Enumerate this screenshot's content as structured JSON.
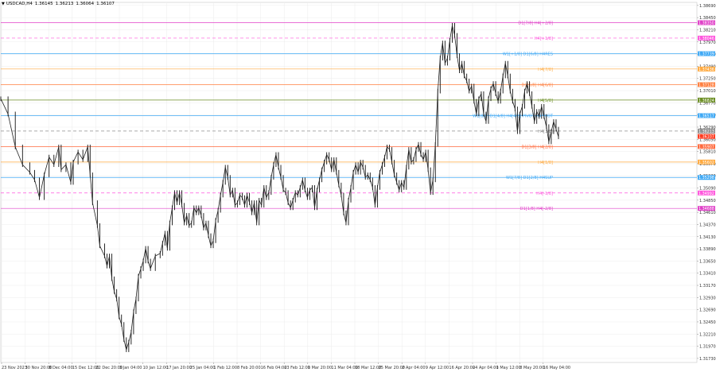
{
  "header": {
    "dropdown_icon": "triangle-down-icon",
    "symbol_tf": "USDCAD,H4",
    "open": "1.36145",
    "high": "1.36213",
    "low": "1.36064",
    "close": "1.36107"
  },
  "chart_data": {
    "type": "candlestick",
    "symbol": "USDCAD",
    "timeframe": "H4",
    "y_ticks": [
      "1.38690",
      "1.38450",
      "1.38210",
      "1.37970",
      "1.37730",
      "1.37490",
      "1.37250",
      "1.37010",
      "1.36770",
      "1.36530",
      "1.36290",
      "1.36050",
      "1.35810",
      "1.35570",
      "1.35330",
      "1.35090",
      "1.34850",
      "1.34610",
      "1.34370",
      "1.34130",
      "1.33890",
      "1.33650",
      "1.33410",
      "1.33170",
      "1.32930",
      "1.32690",
      "1.32450",
      "1.32210",
      "1.31970",
      "1.31730"
    ],
    "ylim": [
      1.3165,
      1.3875
    ],
    "x_ticks": [
      "23 Nov 2023",
      "30 Nov 20:00",
      "8 Dec 04:00",
      "15 Dec 12:00",
      "22 Dec 20:00",
      "3 Jan 04:00",
      "10 Jan 12:00",
      "17 Jan 20:00",
      "25 Jan 04:00",
      "1 Feb 12:00",
      "8 Feb 20:00",
      "16 Feb 04:00",
      "23 Feb 12:00",
      "1 Mar 20:00",
      "11 Mar 04:00",
      "18 Mar 12:00",
      "25 Mar 20:00",
      "2 Apr 04:00",
      "9 Apr 12:00",
      "16 Apr 20:00",
      "24 Apr 04:00",
      "1 May 12:00",
      "8 May 20:00",
      "16 May 04:00"
    ],
    "levels": [
      {
        "label": "D1[7/8] H4[+2/8]",
        "price": 1.3835,
        "price_label": "1.38350",
        "color": "#e040c8",
        "style": "solid"
      },
      {
        "label": "H4[+1/8]",
        "price": 1.38046,
        "price_label": "1.38046",
        "color": "#ff55dd",
        "style": "dashed"
      },
      {
        "label": "W1[+1/8] D1[6/8] H4RES",
        "price": 1.37739,
        "price_label": "1.37739",
        "color": "#3fa9f5",
        "style": "solid"
      },
      {
        "label": "H4[7/8]",
        "price": 1.37436,
        "price_label": "1.37436",
        "color": "#ffaa40",
        "style": "solid"
      },
      {
        "label": "D1[5/8] H4[6/8]",
        "price": 1.37128,
        "price_label": "1.37128",
        "color": "#ff7f3f",
        "style": "solid"
      },
      {
        "label": "H4[5/8]",
        "price": 1.36824,
        "price_label": "1.36824",
        "color": "#6b8e23",
        "style": "solid"
      },
      {
        "label": "W1[8/8] D1[4/8] H4[4/8] PIVOT H4PIVOT",
        "price": 1.36517,
        "price_label": "1.36517",
        "color": "#3fa9f5",
        "style": "solid"
      },
      {
        "label": "H4[3/8]",
        "price": 1.36213,
        "price_label": "1.36213",
        "color": "#8f8f8f",
        "style": "dashed"
      },
      {
        "label": "D1[3/8] H4[2/8]",
        "price": 1.35907,
        "price_label": "1.35907",
        "color": "#ff6a3d",
        "style": "solid"
      },
      {
        "label": "H4[1/8]",
        "price": 1.35602,
        "price_label": "1.35602",
        "color": "#ffaa40",
        "style": "solid"
      },
      {
        "label": "W1[7/8] D1[2/8] H4SUP",
        "price": 1.35298,
        "price_label": "1.35298",
        "color": "#3fa9f5",
        "style": "solid"
      },
      {
        "label": "H4[-1/8]",
        "price": 1.34992,
        "price_label": "1.34992",
        "color": "#ff55dd",
        "style": "dashed"
      },
      {
        "label": "D1[1/8] H4[-2/8]",
        "price": 1.34688,
        "price_label": "1.34688",
        "color": "#e040c8",
        "style": "solid"
      }
    ],
    "current_price": {
      "price": 1.36107,
      "price_label": "1.36107",
      "color": "#ff3b1f"
    },
    "path_points": [
      {
        "x": 0,
        "y": 1.3685
      },
      {
        "x": 3,
        "y": 1.3655
      },
      {
        "x": 6,
        "y": 1.359
      },
      {
        "x": 9,
        "y": 1.3555
      },
      {
        "x": 12,
        "y": 1.354
      },
      {
        "x": 14,
        "y": 1.3525
      },
      {
        "x": 16,
        "y": 1.349
      },
      {
        "x": 18,
        "y": 1.3535
      },
      {
        "x": 20,
        "y": 1.357
      },
      {
        "x": 22,
        "y": 1.3555
      },
      {
        "x": 24,
        "y": 1.359
      },
      {
        "x": 25,
        "y": 1.3545
      },
      {
        "x": 27,
        "y": 1.3555
      },
      {
        "x": 29,
        "y": 1.352
      },
      {
        "x": 30,
        "y": 1.356
      },
      {
        "x": 32,
        "y": 1.358
      },
      {
        "x": 34,
        "y": 1.3565
      },
      {
        "x": 36,
        "y": 1.359
      },
      {
        "x": 37,
        "y": 1.3535
      },
      {
        "x": 38,
        "y": 1.348
      },
      {
        "x": 40,
        "y": 1.3435
      },
      {
        "x": 41,
        "y": 1.3395
      },
      {
        "x": 43,
        "y": 1.3375
      },
      {
        "x": 44,
        "y": 1.3355
      },
      {
        "x": 45,
        "y": 1.3375
      },
      {
        "x": 46,
        "y": 1.333
      },
      {
        "x": 47,
        "y": 1.3305
      },
      {
        "x": 48,
        "y": 1.329
      },
      {
        "x": 49,
        "y": 1.3255
      },
      {
        "x": 50,
        "y": 1.324
      },
      {
        "x": 51,
        "y": 1.321
      },
      {
        "x": 52,
        "y": 1.319
      },
      {
        "x": 53,
        "y": 1.3205
      },
      {
        "x": 54,
        "y": 1.3225
      },
      {
        "x": 55,
        "y": 1.3265
      },
      {
        "x": 56,
        "y": 1.329
      },
      {
        "x": 57,
        "y": 1.3335
      },
      {
        "x": 58,
        "y": 1.335
      },
      {
        "x": 59,
        "y": 1.3365
      },
      {
        "x": 60,
        "y": 1.339
      },
      {
        "x": 61,
        "y": 1.3365
      },
      {
        "x": 62,
        "y": 1.335
      },
      {
        "x": 64,
        "y": 1.3375
      },
      {
        "x": 66,
        "y": 1.338
      },
      {
        "x": 67,
        "y": 1.34
      },
      {
        "x": 68,
        "y": 1.342
      },
      {
        "x": 69,
        "y": 1.339
      },
      {
        "x": 70,
        "y": 1.344
      },
      {
        "x": 71,
        "y": 1.347
      },
      {
        "x": 72,
        "y": 1.35
      },
      {
        "x": 73,
        "y": 1.348
      },
      {
        "x": 74,
        "y": 1.35
      },
      {
        "x": 75,
        "y": 1.3475
      },
      {
        "x": 76,
        "y": 1.344
      },
      {
        "x": 77,
        "y": 1.3455
      },
      {
        "x": 78,
        "y": 1.3435
      },
      {
        "x": 79,
        "y": 1.344
      },
      {
        "x": 80,
        "y": 1.347
      },
      {
        "x": 81,
        "y": 1.346
      },
      {
        "x": 82,
        "y": 1.347
      },
      {
        "x": 83,
        "y": 1.3455
      },
      {
        "x": 84,
        "y": 1.343
      },
      {
        "x": 85,
        "y": 1.344
      },
      {
        "x": 86,
        "y": 1.3415
      },
      {
        "x": 87,
        "y": 1.3395
      },
      {
        "x": 88,
        "y": 1.3405
      },
      {
        "x": 89,
        "y": 1.3445
      },
      {
        "x": 90,
        "y": 1.3465
      },
      {
        "x": 91,
        "y": 1.3495
      },
      {
        "x": 92,
        "y": 1.352
      },
      {
        "x": 93,
        "y": 1.355
      },
      {
        "x": 94,
        "y": 1.353
      },
      {
        "x": 95,
        "y": 1.3495
      },
      {
        "x": 96,
        "y": 1.3505
      },
      {
        "x": 97,
        "y": 1.3475
      },
      {
        "x": 98,
        "y": 1.348
      },
      {
        "x": 99,
        "y": 1.3495
      },
      {
        "x": 100,
        "y": 1.349
      },
      {
        "x": 101,
        "y": 1.3475
      },
      {
        "x": 102,
        "y": 1.3495
      },
      {
        "x": 103,
        "y": 1.348
      },
      {
        "x": 104,
        "y": 1.346
      },
      {
        "x": 105,
        "y": 1.348
      },
      {
        "x": 106,
        "y": 1.344
      },
      {
        "x": 107,
        "y": 1.3485
      },
      {
        "x": 108,
        "y": 1.3475
      },
      {
        "x": 109,
        "y": 1.351
      },
      {
        "x": 110,
        "y": 1.349
      },
      {
        "x": 111,
        "y": 1.35
      },
      {
        "x": 112,
        "y": 1.353
      },
      {
        "x": 113,
        "y": 1.3555
      },
      {
        "x": 114,
        "y": 1.3575
      },
      {
        "x": 115,
        "y": 1.355
      },
      {
        "x": 116,
        "y": 1.353
      },
      {
        "x": 117,
        "y": 1.3505
      },
      {
        "x": 118,
        "y": 1.35
      },
      {
        "x": 119,
        "y": 1.348
      },
      {
        "x": 120,
        "y": 1.347
      },
      {
        "x": 121,
        "y": 1.3485
      },
      {
        "x": 122,
        "y": 1.35
      },
      {
        "x": 123,
        "y": 1.3495
      },
      {
        "x": 124,
        "y": 1.351
      },
      {
        "x": 125,
        "y": 1.3525
      },
      {
        "x": 126,
        "y": 1.3505
      },
      {
        "x": 127,
        "y": 1.349
      },
      {
        "x": 128,
        "y": 1.3505
      },
      {
        "x": 129,
        "y": 1.351
      },
      {
        "x": 130,
        "y": 1.347
      },
      {
        "x": 131,
        "y": 1.3505
      },
      {
        "x": 132,
        "y": 1.3525
      },
      {
        "x": 133,
        "y": 1.3545
      },
      {
        "x": 134,
        "y": 1.356
      },
      {
        "x": 135,
        "y": 1.3575
      },
      {
        "x": 136,
        "y": 1.3565
      },
      {
        "x": 137,
        "y": 1.3545
      },
      {
        "x": 138,
        "y": 1.3565
      },
      {
        "x": 139,
        "y": 1.354
      },
      {
        "x": 140,
        "y": 1.3515
      },
      {
        "x": 141,
        "y": 1.3495
      },
      {
        "x": 142,
        "y": 1.346
      },
      {
        "x": 143,
        "y": 1.344
      },
      {
        "x": 144,
        "y": 1.3485
      },
      {
        "x": 145,
        "y": 1.351
      },
      {
        "x": 146,
        "y": 1.354
      },
      {
        "x": 147,
        "y": 1.3555
      },
      {
        "x": 148,
        "y": 1.354
      },
      {
        "x": 149,
        "y": 1.356
      },
      {
        "x": 150,
        "y": 1.355
      },
      {
        "x": 151,
        "y": 1.353
      },
      {
        "x": 152,
        "y": 1.3535
      },
      {
        "x": 153,
        "y": 1.3525
      },
      {
        "x": 154,
        "y": 1.351
      },
      {
        "x": 155,
        "y": 1.3475
      },
      {
        "x": 156,
        "y": 1.351
      },
      {
        "x": 157,
        "y": 1.354
      },
      {
        "x": 158,
        "y": 1.3555
      },
      {
        "x": 159,
        "y": 1.357
      },
      {
        "x": 160,
        "y": 1.359
      },
      {
        "x": 161,
        "y": 1.3585
      },
      {
        "x": 162,
        "y": 1.356
      },
      {
        "x": 163,
        "y": 1.3535
      },
      {
        "x": 164,
        "y": 1.352
      },
      {
        "x": 165,
        "y": 1.3505
      },
      {
        "x": 166,
        "y": 1.352
      },
      {
        "x": 167,
        "y": 1.351
      },
      {
        "x": 168,
        "y": 1.355
      },
      {
        "x": 169,
        "y": 1.3585
      },
      {
        "x": 170,
        "y": 1.356
      },
      {
        "x": 171,
        "y": 1.3565
      },
      {
        "x": 172,
        "y": 1.3585
      },
      {
        "x": 173,
        "y": 1.3595
      },
      {
        "x": 174,
        "y": 1.3575
      },
      {
        "x": 175,
        "y": 1.3565
      },
      {
        "x": 176,
        "y": 1.358
      },
      {
        "x": 177,
        "y": 1.3545
      },
      {
        "x": 178,
        "y": 1.35
      },
      {
        "x": 179,
        "y": 1.3525
      },
      {
        "x": 180,
        "y": 1.3595
      },
      {
        "x": 181,
        "y": 1.37
      },
      {
        "x": 182,
        "y": 1.3765
      },
      {
        "x": 183,
        "y": 1.3795
      },
      {
        "x": 184,
        "y": 1.3755
      },
      {
        "x": 185,
        "y": 1.3765
      },
      {
        "x": 186,
        "y": 1.38
      },
      {
        "x": 187,
        "y": 1.383
      },
      {
        "x": 188,
        "y": 1.381
      },
      {
        "x": 189,
        "y": 1.377
      },
      {
        "x": 190,
        "y": 1.374
      },
      {
        "x": 191,
        "y": 1.3755
      },
      {
        "x": 192,
        "y": 1.373
      },
      {
        "x": 193,
        "y": 1.372
      },
      {
        "x": 194,
        "y": 1.37
      },
      {
        "x": 195,
        "y": 1.371
      },
      {
        "x": 196,
        "y": 1.368
      },
      {
        "x": 197,
        "y": 1.3655
      },
      {
        "x": 198,
        "y": 1.3685
      },
      {
        "x": 199,
        "y": 1.3695
      },
      {
        "x": 200,
        "y": 1.3655
      },
      {
        "x": 201,
        "y": 1.364
      },
      {
        "x": 202,
        "y": 1.3685
      },
      {
        "x": 203,
        "y": 1.3705
      },
      {
        "x": 204,
        "y": 1.3715
      },
      {
        "x": 205,
        "y": 1.3695
      },
      {
        "x": 206,
        "y": 1.368
      },
      {
        "x": 207,
        "y": 1.37
      },
      {
        "x": 208,
        "y": 1.373
      },
      {
        "x": 209,
        "y": 1.3755
      },
      {
        "x": 210,
        "y": 1.373
      },
      {
        "x": 211,
        "y": 1.37
      },
      {
        "x": 212,
        "y": 1.368
      },
      {
        "x": 213,
        "y": 1.3665
      },
      {
        "x": 214,
        "y": 1.362
      },
      {
        "x": 215,
        "y": 1.3655
      },
      {
        "x": 216,
        "y": 1.367
      },
      {
        "x": 217,
        "y": 1.37
      },
      {
        "x": 218,
        "y": 1.3715
      },
      {
        "x": 219,
        "y": 1.3695
      },
      {
        "x": 220,
        "y": 1.367
      },
      {
        "x": 221,
        "y": 1.364
      },
      {
        "x": 222,
        "y": 1.366
      },
      {
        "x": 223,
        "y": 1.365
      },
      {
        "x": 224,
        "y": 1.367
      },
      {
        "x": 225,
        "y": 1.365
      },
      {
        "x": 226,
        "y": 1.363
      },
      {
        "x": 227,
        "y": 1.36
      },
      {
        "x": 228,
        "y": 1.362
      },
      {
        "x": 229,
        "y": 1.364
      },
      {
        "x": 230,
        "y": 1.3625
      },
      {
        "x": 231,
        "y": 1.361
      }
    ]
  }
}
